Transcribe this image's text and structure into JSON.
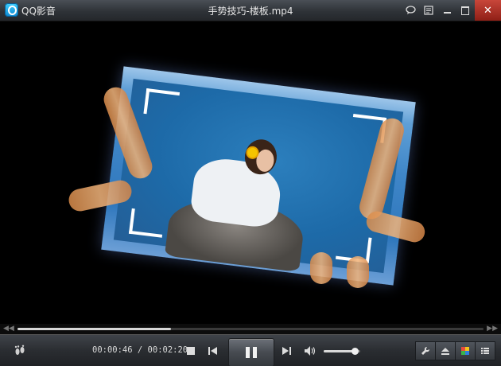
{
  "app": {
    "name": "QQ影音",
    "window_title": "手势技巧-楼板.mp4"
  },
  "titlebar": {
    "icons": [
      "chat-icon",
      "menu-icon",
      "minimize-icon",
      "maximize-icon",
      "close-icon"
    ],
    "close_color": "#c23a2e"
  },
  "playback": {
    "current_time": "00:00:46",
    "total_time": "00:02:20",
    "time_separator": " / ",
    "progress_fraction": 0.329,
    "volume_fraction": 0.85,
    "state": "playing"
  },
  "controls": {
    "icons": [
      "footprint-icon",
      "stop-icon",
      "previous-icon",
      "pause-icon",
      "next-icon",
      "volume-icon",
      "wrench-icon",
      "eject-icon",
      "color-icon",
      "list-icon"
    ]
  }
}
